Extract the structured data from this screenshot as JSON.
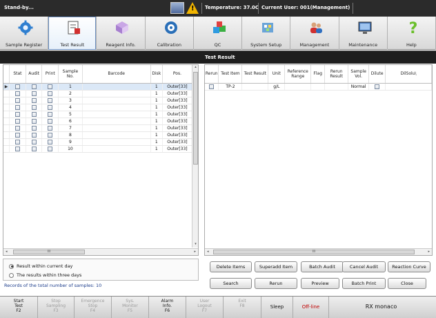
{
  "statusbar": {
    "state": "Stand-by...",
    "temperature": "Temperature: 37.0C",
    "current_user": "Current User: 001(Management)",
    "warning_glyph": "!"
  },
  "toolbar": [
    {
      "label": "Sample Register",
      "icon": "gear-icon"
    },
    {
      "label": "Test Result",
      "icon": "test-result-icon"
    },
    {
      "label": "Reagent Info.",
      "icon": "reagent-icon"
    },
    {
      "label": "Calibration",
      "icon": "calibration-icon"
    },
    {
      "label": "QC",
      "icon": "qc-cubes-icon"
    },
    {
      "label": "System Setup",
      "icon": "system-setup-icon"
    },
    {
      "label": "Management",
      "icon": "users-icon"
    },
    {
      "label": "Maintenance",
      "icon": "monitor-icon"
    },
    {
      "label": "Help",
      "icon": "help-icon"
    }
  ],
  "title": "Test Result",
  "samples": {
    "headers": {
      "stat": "Stat",
      "audit": "Audit",
      "print": "Print",
      "sample_no": "Sample No.",
      "barcode": "Barcode",
      "disk": "Disk",
      "pos": "Pos."
    },
    "rows": [
      {
        "no": "1",
        "disk": "1",
        "pos": "Outer[33]"
      },
      {
        "no": "2",
        "disk": "1",
        "pos": "Outer[33]"
      },
      {
        "no": "3",
        "disk": "1",
        "pos": "Outer[33]"
      },
      {
        "no": "4",
        "disk": "1",
        "pos": "Outer[33]"
      },
      {
        "no": "5",
        "disk": "1",
        "pos": "Outer[33]"
      },
      {
        "no": "6",
        "disk": "1",
        "pos": "Outer[33]"
      },
      {
        "no": "7",
        "disk": "1",
        "pos": "Outer[33]"
      },
      {
        "no": "8",
        "disk": "1",
        "pos": "Outer[33]"
      },
      {
        "no": "9",
        "disk": "1",
        "pos": "Outer[33]"
      },
      {
        "no": "10",
        "disk": "1",
        "pos": "Outer[33]"
      }
    ],
    "row_indicator": "▶"
  },
  "results": {
    "headers": {
      "rerun": "Rerun",
      "test_item": "Test Item",
      "test_result": "Test Result",
      "unit": "Unit",
      "ref_range": "Reference Range",
      "flag": "Flag",
      "rerun_result": "Rerun Result",
      "sample_vol": "Sample Vol.",
      "dilute": "Dilute",
      "dilsolu": "DilSolu\\"
    },
    "rows": [
      {
        "test_item": "TP-2",
        "test_result": "",
        "unit": "g/L",
        "ref_range": "",
        "flag": "",
        "rerun_result": "",
        "sample_vol": "Normal"
      }
    ]
  },
  "scroll": {
    "grip": "III",
    "left_arrow": "◂",
    "right_arrow": "▸",
    "up_arrow": "▴",
    "down_arrow": "▾"
  },
  "filter": {
    "option_current_day": "Result within current day",
    "option_three_days": "The results within three days",
    "selected": "current_day"
  },
  "records_text": "Records of the total number of samples: 10",
  "actions": {
    "delete_items": "Delete Items",
    "superadd_item": "Superadd Item",
    "batch_audit": "Batch Audit",
    "cancel_audit": "Cancel Audit",
    "reaction_curve": "Reaction Curve",
    "search": "Search",
    "rerun": "Rerun",
    "preview": "Preview",
    "batch_print": "Batch Print",
    "close": "Close"
  },
  "fkeys": [
    {
      "line1": "Start",
      "line2": "Test",
      "key": "F2",
      "enabled": true
    },
    {
      "line1": "Stop",
      "line2": "Sampling",
      "key": "F3",
      "enabled": false
    },
    {
      "line1": "Emergence",
      "line2": "Stop",
      "key": "F4",
      "enabled": false
    },
    {
      "line1": "Sys.",
      "line2": "Monitor",
      "key": "F5",
      "enabled": false
    },
    {
      "line1": "Alarm",
      "line2": "Info.",
      "key": "F6",
      "enabled": true
    },
    {
      "line1": "User",
      "line2": "Logout",
      "key": "F7",
      "enabled": false
    },
    {
      "line1": "Exit",
      "line2": "",
      "key": "F8",
      "enabled": false
    }
  ],
  "sleep": "Sleep",
  "offline": "Off-line",
  "brand": "RX monaco",
  "colors": {
    "offline": "#c00000",
    "records_text": "#1a3b8a",
    "selection": "#dbe8f7"
  }
}
